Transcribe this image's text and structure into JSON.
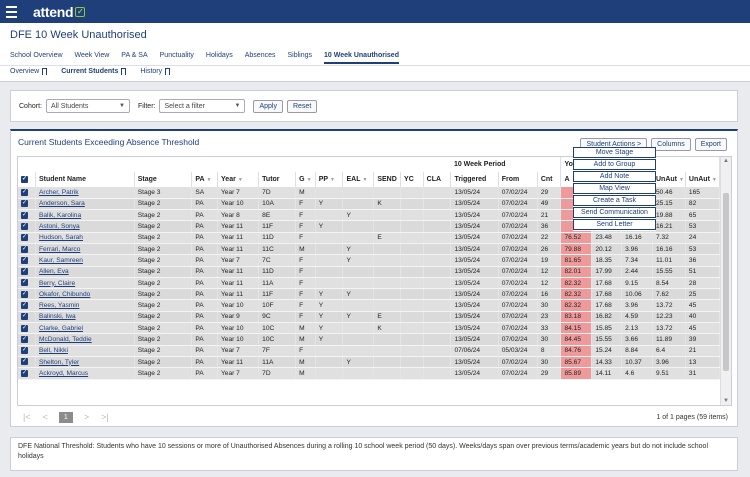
{
  "app": {
    "logo_text": "attend"
  },
  "page": {
    "title": "DFE 10 Week Unauthorised"
  },
  "tabs": [
    "School Overview",
    "Week View",
    "PA & SA",
    "Punctuality",
    "Holidays",
    "Absences",
    "Siblings",
    "10 Week Unauthorised"
  ],
  "active_tab": "10 Week Unauthorised",
  "subtabs": [
    "Overview",
    "Current Students",
    "History"
  ],
  "filters": {
    "cohort_label": "Cohort:",
    "cohort_value": "All Students",
    "filter_label": "Filter:",
    "filter_placeholder": "Select a filter",
    "apply_label": "Apply",
    "reset_label": "Reset"
  },
  "panel": {
    "title": "Current Students Exceeding Absence Threshold",
    "student_actions_label": "Student Actions >",
    "columns_label": "Columns",
    "export_label": "Export"
  },
  "grid": {
    "group_header": "10 Week Period",
    "group_header_2": "Yo",
    "columns": [
      "Student Name",
      "Stage",
      "PA",
      "Year",
      "Tutor",
      "G",
      "PP",
      "EAL",
      "SEND",
      "YC",
      "CLA",
      "Triggered",
      "From",
      "Cnt",
      "A",
      "",
      "",
      "UnAut",
      "UnAut"
    ],
    "rows": [
      [
        "Archer, Patrik",
        "Stage 3",
        "SA",
        "Year 7",
        "7D",
        "M",
        "",
        "",
        "",
        "",
        "",
        "13/05/24",
        "07/02/24",
        "29",
        "",
        "",
        "",
        "50.46",
        "165"
      ],
      [
        "Anderson, Sara",
        "Stage 2",
        "PA",
        "Year 10",
        "10A",
        "F",
        "Y",
        "",
        "K",
        "",
        "",
        "13/05/24",
        "07/02/24",
        "49",
        "",
        "",
        "",
        "25.15",
        "82"
      ],
      [
        "Balik, Karolina",
        "Stage 2",
        "PA",
        "Year 8",
        "8E",
        "F",
        "",
        "Y",
        "",
        "",
        "",
        "13/05/24",
        "07/02/24",
        "21",
        "",
        "",
        "",
        "19.88",
        "65"
      ],
      [
        "Astoni, Sonya",
        "Stage 2",
        "PA",
        "Year 11",
        "11F",
        "F",
        "Y",
        "",
        "",
        "",
        "",
        "13/05/24",
        "07/02/24",
        "36",
        "",
        "",
        "",
        "16.21",
        "53"
      ],
      [
        "Hudson, Sarah",
        "Stage 2",
        "PA",
        "Year 11",
        "11D",
        "F",
        "",
        "",
        "E",
        "",
        "",
        "13/05/24",
        "07/02/24",
        "22",
        "76.52",
        "23.48",
        "16.16",
        "7.32",
        "24"
      ],
      [
        "Ferrari, Marco",
        "Stage 2",
        "PA",
        "Year 11",
        "11C",
        "M",
        "",
        "Y",
        "",
        "",
        "",
        "13/05/24",
        "07/02/24",
        "26",
        "79.88",
        "20.12",
        "3.96",
        "16.16",
        "53"
      ],
      [
        "Kaur, Samreen",
        "Stage 2",
        "PA",
        "Year 7",
        "7C",
        "F",
        "",
        "Y",
        "",
        "",
        "",
        "13/05/24",
        "07/02/24",
        "19",
        "81.65",
        "18.35",
        "7.34",
        "11.01",
        "36"
      ],
      [
        "Allen, Eva",
        "Stage 2",
        "PA",
        "Year 11",
        "11D",
        "F",
        "",
        "",
        "",
        "",
        "",
        "13/05/24",
        "07/02/24",
        "12",
        "82.01",
        "17.99",
        "2.44",
        "15.55",
        "51"
      ],
      [
        "Berry, Claire",
        "Stage 2",
        "PA",
        "Year 11",
        "11A",
        "F",
        "",
        "",
        "",
        "",
        "",
        "13/05/24",
        "07/02/24",
        "12",
        "82.32",
        "17.68",
        "9.15",
        "8.54",
        "28"
      ],
      [
        "Okafor, Chibundo",
        "Stage 2",
        "PA",
        "Year 11",
        "11F",
        "F",
        "Y",
        "Y",
        "",
        "",
        "",
        "13/05/24",
        "07/02/24",
        "16",
        "82.32",
        "17.68",
        "10.06",
        "7.62",
        "25"
      ],
      [
        "Rees, Yasmin",
        "Stage 2",
        "PA",
        "Year 10",
        "10F",
        "F",
        "Y",
        "",
        "",
        "",
        "",
        "13/05/24",
        "07/02/24",
        "30",
        "82.32",
        "17.68",
        "3.96",
        "13.72",
        "45"
      ],
      [
        "Balinski, Iwa",
        "Stage 2",
        "PA",
        "Year 9",
        "9C",
        "F",
        "Y",
        "Y",
        "E",
        "",
        "",
        "13/05/24",
        "07/02/24",
        "23",
        "83.18",
        "16.82",
        "4.59",
        "12.23",
        "40"
      ],
      [
        "Clarke, Gabriel",
        "Stage 2",
        "PA",
        "Year 10",
        "10C",
        "M",
        "Y",
        "",
        "K",
        "",
        "",
        "13/05/24",
        "07/02/24",
        "33",
        "84.15",
        "15.85",
        "2.13",
        "13.72",
        "45"
      ],
      [
        "McDonald, Teddie",
        "Stage 2",
        "PA",
        "Year 10",
        "10C",
        "M",
        "Y",
        "",
        "",
        "",
        "",
        "13/05/24",
        "07/02/24",
        "30",
        "84.45",
        "15.55",
        "3.66",
        "11.89",
        "39"
      ],
      [
        "Bell, Nikki",
        "Stage 2",
        "PA",
        "Year 7",
        "7F",
        "F",
        "",
        "",
        "",
        "",
        "",
        "07/06/24",
        "05/03/24",
        "8",
        "84.76",
        "15.24",
        "8.84",
        "6.4",
        "21"
      ],
      [
        "Shelton, Tyler",
        "Stage 2",
        "PA",
        "Year 11",
        "11A",
        "M",
        "",
        "Y",
        "",
        "",
        "",
        "13/05/24",
        "07/02/24",
        "30",
        "85.67",
        "14.33",
        "10.37",
        "3.96",
        "13"
      ],
      [
        "Ackroyd, Marcus",
        "Stage 2",
        "PA",
        "Year 7",
        "7D",
        "M",
        "",
        "",
        "",
        "",
        "",
        "13/05/24",
        "07/02/24",
        "29",
        "85.89",
        "14.11",
        "4.6",
        "9.51",
        "31"
      ]
    ]
  },
  "actions_menu": [
    "Move Stage",
    "Add to Group",
    "Add Note",
    "Map View",
    "Create a Task",
    "Send Communication",
    "Send Letter"
  ],
  "pager": {
    "current": "1",
    "info": "1 of 1 pages (59 items)"
  },
  "footer": {
    "text": "DFE National Threshold: Students who have 10 sessions or more of Unauthorised Absences during a rolling 10 school week period (50 days). Weeks/days span over previous terms/academic years but do not include school holidays"
  },
  "colors": {
    "brand": "#1f3f7a",
    "highlight": "#ef9a9a",
    "accent": "#8ec63f"
  }
}
